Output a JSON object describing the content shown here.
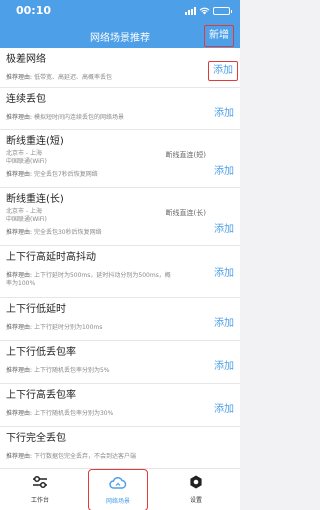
{
  "status": {
    "time": "00:10"
  },
  "nav": {
    "title": "网络场景推荐",
    "add": "新增"
  },
  "reason_label": "推荐理由:",
  "add_label": "添加",
  "items": [
    {
      "title": "极差网络",
      "reason": "低带宽、高延迟、高概率丢包",
      "highlight": true
    },
    {
      "title": "连续丢包",
      "reason": "模拟短时间内连续丢包的网络场景"
    },
    {
      "title": "断线重连(短)",
      "lines": [
        "北京市 - 上海",
        "中国联通(WiFi)"
      ],
      "right": "断线直连(短)",
      "reason": "完全丢包7秒后恢复网络"
    },
    {
      "title": "断线重连(长)",
      "lines": [
        "北京市 - 上海",
        "中国联通(WiFi)"
      ],
      "right": "断线直连(长)",
      "reason": "完全丢包30秒后恢复网络"
    },
    {
      "title": "上下行高延时高抖动",
      "reason": "上下行延时为500ms，延时抖动分别为500ms，概率为100%"
    },
    {
      "title": "上下行低延时",
      "reason": "上下行延时分别为100ms"
    },
    {
      "title": "上下行低丢包率",
      "reason": "上下行随机丢包率分别为5%"
    },
    {
      "title": "上下行高丢包率",
      "reason": "上下行随机丢包率分别为30%"
    },
    {
      "title": "下行完全丢包",
      "reason": "下行数据包完全丢弃，不会到达客户端"
    }
  ],
  "tabs": [
    {
      "label": "工作台",
      "icon": "sliders-icon"
    },
    {
      "label": "网络场景",
      "icon": "cloud-icon",
      "active": true
    },
    {
      "label": "设置",
      "icon": "gear-icon"
    }
  ],
  "colors": {
    "accent": "#4d9fe7",
    "highlight": "#e03a3a"
  }
}
